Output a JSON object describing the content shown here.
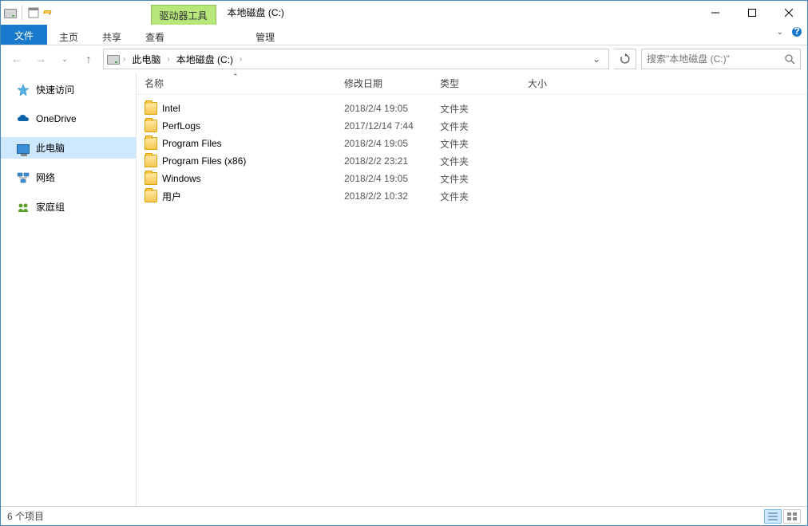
{
  "window": {
    "contextual_tab": "驱动器工具",
    "title": "本地磁盘 (C:)"
  },
  "ribbon": {
    "file": "文件",
    "tabs": [
      "主页",
      "共享",
      "查看"
    ],
    "context_tab": "管理"
  },
  "nav": {
    "breadcrumb_root": "此电脑",
    "breadcrumb_current": "本地磁盘 (C:)",
    "search_placeholder": "搜索\"本地磁盘 (C:)\""
  },
  "sidebar": {
    "items": [
      {
        "label": "快速访问",
        "icon": "star"
      },
      {
        "label": "OneDrive",
        "icon": "cloud"
      },
      {
        "label": "此电脑",
        "icon": "pc",
        "selected": true
      },
      {
        "label": "网络",
        "icon": "network"
      },
      {
        "label": "家庭组",
        "icon": "homegroup"
      }
    ]
  },
  "columns": {
    "name": "名称",
    "date": "修改日期",
    "type": "类型",
    "size": "大小"
  },
  "files": [
    {
      "name": "Intel",
      "date": "2018/2/4 19:05",
      "type": "文件夹"
    },
    {
      "name": "PerfLogs",
      "date": "2017/12/14 7:44",
      "type": "文件夹"
    },
    {
      "name": "Program Files",
      "date": "2018/2/4 19:05",
      "type": "文件夹"
    },
    {
      "name": "Program Files (x86)",
      "date": "2018/2/2 23:21",
      "type": "文件夹"
    },
    {
      "name": "Windows",
      "date": "2018/2/4 19:05",
      "type": "文件夹"
    },
    {
      "name": "用户",
      "date": "2018/2/2 10:32",
      "type": "文件夹"
    }
  ],
  "status": {
    "text": "6 个项目"
  }
}
